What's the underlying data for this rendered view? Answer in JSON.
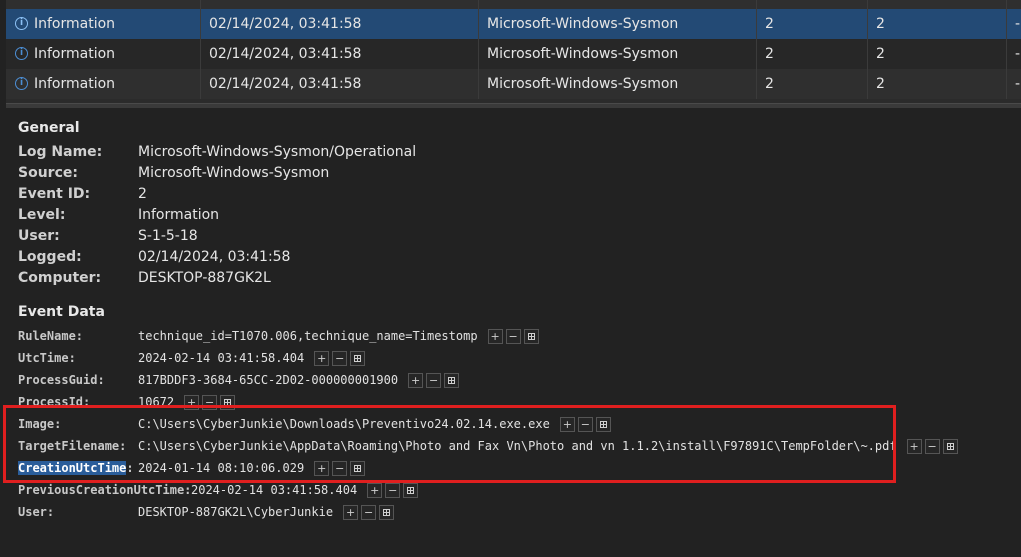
{
  "event_rows": [
    {
      "level": "Information",
      "date": "02/14/2024, 03:41:58",
      "source": "Microsoft-Windows-Sysmon",
      "event_id": "2",
      "task": "2",
      "more": "-"
    },
    {
      "level": "Information",
      "date": "02/14/2024, 03:41:58",
      "source": "Microsoft-Windows-Sysmon",
      "event_id": "2",
      "task": "2",
      "more": "-"
    },
    {
      "level": "Information",
      "date": "02/14/2024, 03:41:58",
      "source": "Microsoft-Windows-Sysmon",
      "event_id": "2",
      "task": "2",
      "more": "-"
    }
  ],
  "general": {
    "title": "General",
    "fields": [
      {
        "label": "Log Name:",
        "value": "Microsoft-Windows-Sysmon/Operational"
      },
      {
        "label": "Source:",
        "value": "Microsoft-Windows-Sysmon"
      },
      {
        "label": "Event ID:",
        "value": "2"
      },
      {
        "label": "Level:",
        "value": "Information"
      },
      {
        "label": "User:",
        "value": "S-1-5-18"
      },
      {
        "label": "Logged:",
        "value": "02/14/2024, 03:41:58"
      },
      {
        "label": "Computer:",
        "value": "DESKTOP-887GK2L"
      }
    ]
  },
  "event_data": {
    "title": "Event Data",
    "fields": [
      {
        "label": "RuleName:",
        "value": "technique_id=T1070.006,technique_name=Timestomp"
      },
      {
        "label": "UtcTime:",
        "value": "2024-02-14 03:41:58.404"
      },
      {
        "label": "ProcessGuid:",
        "value": "817BDDF3-3684-65CC-2D02-000000001900"
      },
      {
        "label": "ProcessId:",
        "value": "10672"
      },
      {
        "label": "Image:",
        "value": "C:\\Users\\CyberJunkie\\Downloads\\Preventivo24.02.14.exe.exe"
      },
      {
        "label": "TargetFilename:",
        "value": "C:\\Users\\CyberJunkie\\AppData\\Roaming\\Photo and Fax Vn\\Photo and vn 1.1.2\\install\\F97891C\\TempFolder\\~.pdf"
      },
      {
        "label": "CreationUtcTime",
        "value": "2024-01-14 08:10:06.029"
      },
      {
        "label": "PreviousCreationUtcTime:",
        "value": "2024-02-14 03:41:58.404"
      },
      {
        "label": "User:",
        "value": "DESKTOP-887GK2L\\CyberJunkie"
      }
    ]
  },
  "buttons": {
    "add": "+",
    "remove": "−"
  },
  "colors": {
    "selection": "#234a75",
    "highlight_box": "#e01f1f",
    "label_highlight": "#2a5d9a"
  }
}
